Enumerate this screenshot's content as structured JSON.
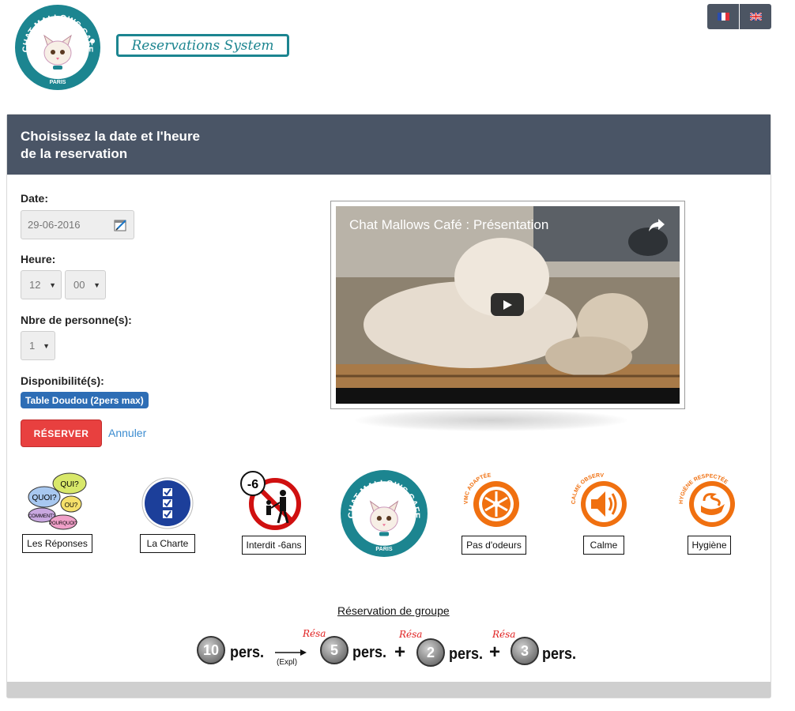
{
  "header": {
    "brand": "Reservations System",
    "logo_ring_text": "CHAT MALLOWS CAFE",
    "logo_city": "PARIS",
    "languages": [
      {
        "code": "fr",
        "icon": "flag-fr-icon"
      },
      {
        "code": "en",
        "icon": "flag-uk-icon"
      }
    ]
  },
  "panel": {
    "title_line1": "Choisissez la date et l'heure",
    "title_line2": "de la reservation"
  },
  "form": {
    "date_label": "Date:",
    "date_value": "29-06-2016",
    "heure_label": "Heure:",
    "hour_value": "12",
    "minute_value": "00",
    "persons_label": "Nbre de personne(s):",
    "persons_value": "1",
    "dispo_label": "Disponibilité(s):",
    "dispo_badge": "Table Doudou (2pers max)",
    "reserve_button": "RÉSERVER",
    "cancel_link": "Annuler"
  },
  "video": {
    "title": "Chat Mallows Café : Présentation"
  },
  "icons_row": {
    "reponses_bubbles": [
      "QUI?",
      "QUOI?",
      "OU?",
      "COMMENT?",
      "POURQUOI?"
    ],
    "reponses": "Les Réponses",
    "charte": "La  Charte",
    "interdit_badge": "-6",
    "interdit": "Interdit -6ans",
    "vmc_arc": "VMC ADAPTÉE",
    "odeurs": "Pas d'odeurs",
    "calme_arc": "CALME OBSERVÉ",
    "calme": "Calme",
    "hygiene_arc": "HYGIÈNE RESPECTÉE",
    "hygiene": "Hygiène"
  },
  "group": {
    "title": "Réservation de groupe",
    "total": "10",
    "pers": "pers.",
    "expl": "(Expl)",
    "resa": "Résa",
    "parts": [
      "5",
      "2",
      "3"
    ]
  }
}
